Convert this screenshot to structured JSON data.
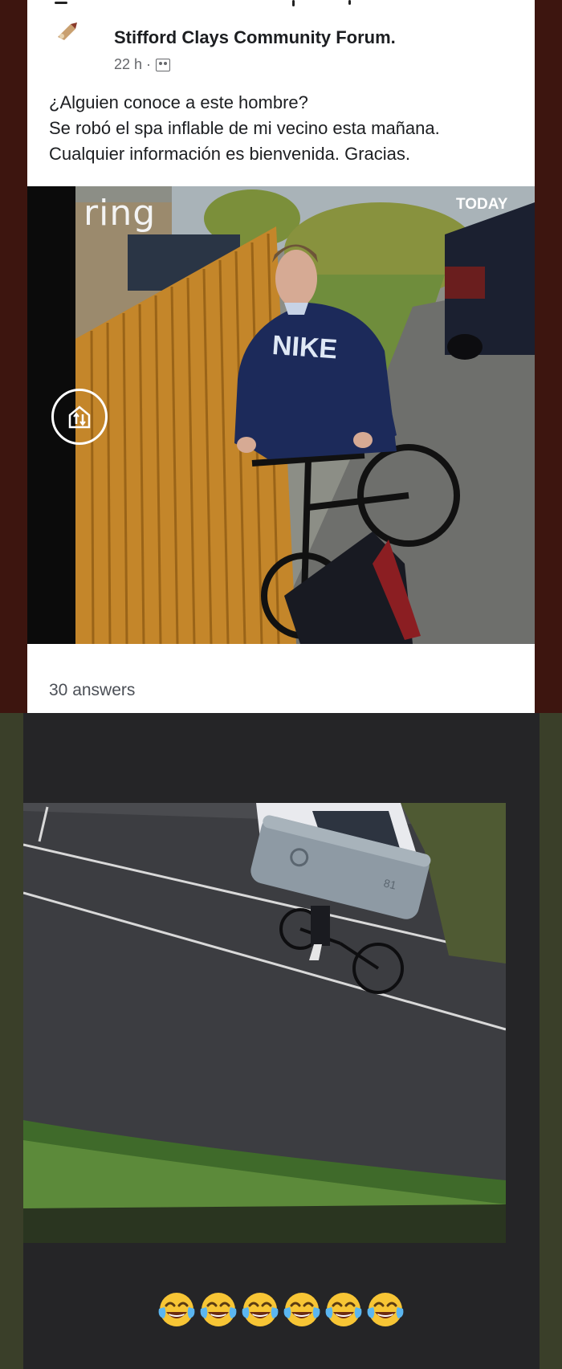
{
  "post": {
    "group_name": "Stifford Clays Community Forum.",
    "time": "22 h ·",
    "text_lines": [
      "¿Alguien conoce a este hombre?",
      "Se robó el spa inflable de mi vecino esta mañana.",
      "Cualquier información es bienvenida. Gracias."
    ],
    "answers_count": "30 answers"
  },
  "camera": {
    "brand": "ring",
    "day_label": "TODAY",
    "shirt_text": "NIKE"
  },
  "reaction": {
    "emoji_count": 6,
    "emoji": "face-with-tears-of-joy"
  },
  "colors": {
    "left_border_top": "#3d150f",
    "left_border_bottom": "#3a3f29",
    "fence": "#c88a2a",
    "hoodie": "#1c2a5a"
  }
}
